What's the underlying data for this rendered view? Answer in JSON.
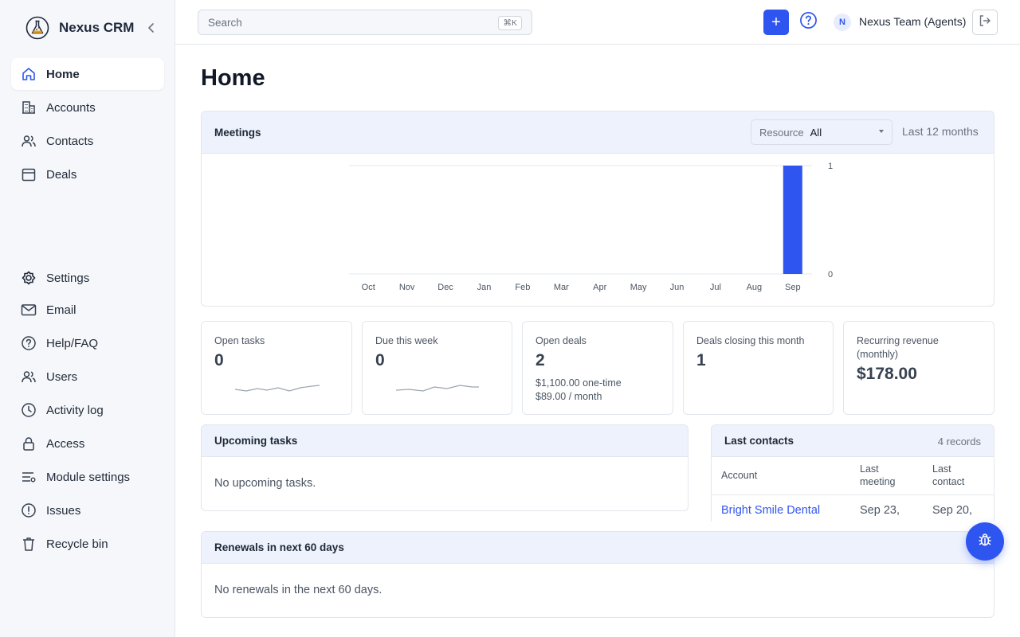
{
  "app": {
    "name": "Nexus CRM"
  },
  "sidebar": {
    "primary": [
      {
        "label": "Home",
        "icon": "home-icon",
        "active": true
      },
      {
        "label": "Accounts",
        "icon": "building-icon"
      },
      {
        "label": "Contacts",
        "icon": "users-icon"
      },
      {
        "label": "Deals",
        "icon": "calendar-icon"
      }
    ],
    "settings_label": "Settings",
    "secondary": [
      {
        "label": "Email",
        "icon": "mail-icon"
      },
      {
        "label": "Help/FAQ",
        "icon": "help-icon"
      },
      {
        "label": "Users",
        "icon": "users-icon"
      },
      {
        "label": "Activity log",
        "icon": "clock-icon"
      },
      {
        "label": "Access",
        "icon": "lock-icon"
      },
      {
        "label": "Module settings",
        "icon": "sliders-icon"
      },
      {
        "label": "Issues",
        "icon": "alert-icon"
      },
      {
        "label": "Recycle bin",
        "icon": "trash-icon"
      }
    ]
  },
  "topbar": {
    "search_placeholder": "Search",
    "search_shortcut": "⌘K",
    "add_label": "+",
    "avatar_initial": "N",
    "team_name": "Nexus Team (Agents)"
  },
  "page": {
    "title": "Home"
  },
  "meetings": {
    "title": "Meetings",
    "resource_label": "Resource",
    "resource_value": "All",
    "range_label": "Last 12 months"
  },
  "chart_data": {
    "type": "bar",
    "categories": [
      "Oct",
      "Nov",
      "Dec",
      "Jan",
      "Feb",
      "Mar",
      "Apr",
      "May",
      "Jun",
      "Jul",
      "Aug",
      "Sep"
    ],
    "values": [
      0,
      0,
      0,
      0,
      0,
      0,
      0,
      0,
      0,
      0,
      0,
      1
    ],
    "ylim": [
      0,
      1
    ],
    "yticks": [
      "0",
      "1"
    ],
    "color": "#2f55f0",
    "grid": true,
    "y_axis_side": "right"
  },
  "stats": [
    {
      "label": "Open tasks",
      "value": "0",
      "sparkline": true
    },
    {
      "label": "Due this week",
      "value": "0",
      "sparkline": true
    },
    {
      "label": "Open deals",
      "value": "2",
      "sub1": "$1,100.00 one-time",
      "sub2": "$89.00 / month"
    },
    {
      "label": "Deals closing this month",
      "value": "1"
    },
    {
      "label": "Recurring revenue (monthly)",
      "value": "$178.00"
    }
  ],
  "upcoming": {
    "title": "Upcoming tasks",
    "empty": "No upcoming tasks."
  },
  "contacts": {
    "title": "Last contacts",
    "records": "4 records",
    "columns": [
      "Account",
      "Last meeting",
      "Last contact"
    ],
    "rows": [
      {
        "account": "Bright Smile Dental",
        "last_meeting": "Sep 23,",
        "last_contact": "Sep 20,"
      }
    ]
  },
  "renewals": {
    "title": "Renewals in next 60 days",
    "empty": "No renewals in the next 60 days."
  },
  "colors": {
    "accent": "#2f55f0",
    "header_tint": "#eef2fd",
    "sidebar_bg": "#f5f7fa"
  }
}
